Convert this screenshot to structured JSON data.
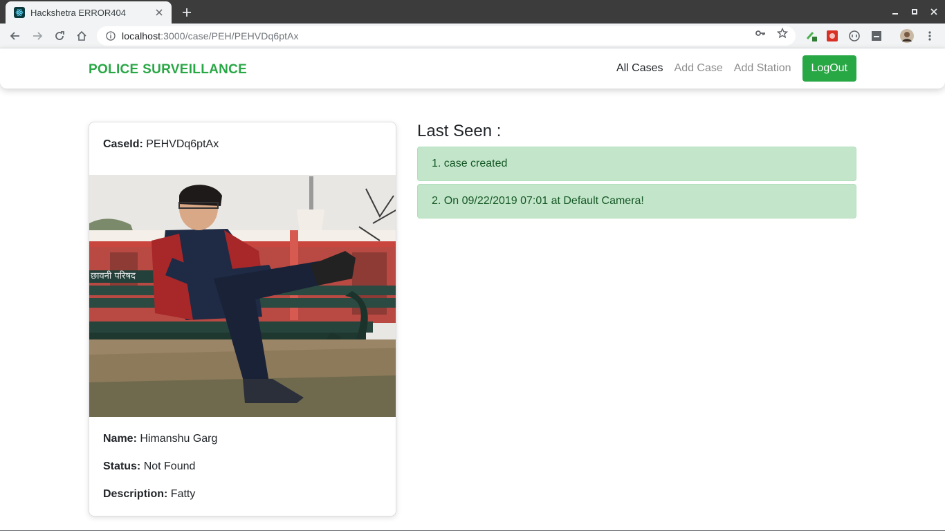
{
  "browser": {
    "tab_title": "Hackshetra ERROR404",
    "url_host": "localhost",
    "url_path": ":3000/case/PEH/PEHVDq6ptAx",
    "icons": [
      "react-favicon-icon",
      "close-icon",
      "plus-icon",
      "minimize-icon",
      "maximize-icon",
      "window-close-icon",
      "back-arrow-icon",
      "forward-arrow-icon",
      "reload-icon",
      "home-icon",
      "info-icon",
      "key-icon",
      "star-icon",
      "extension-icon",
      "profile-avatar-icon",
      "kebab-menu-icon"
    ]
  },
  "navbar": {
    "brand": "POLICE SURVEILLANCE",
    "links": [
      "All Cases",
      "Add Case",
      "Add Station"
    ],
    "logout_label": "LogOut",
    "brand_color": "#28a745"
  },
  "case": {
    "case_id_label": "CaseId:",
    "case_id_value": "PEHVDq6ptAx",
    "photo_sign_text": "छावनी परिषद",
    "name_label": "Name:",
    "name_value": "Himanshu Garg",
    "status_label": "Status:",
    "status_value": "Not Found",
    "description_label": "Description:",
    "description_value": "Fatty"
  },
  "last_seen": {
    "title": "Last Seen :",
    "items": [
      "1. case created",
      "2. On 09/22/2019 07:01 at Default Camera!"
    ],
    "item_bg_color": "#c3e6cb",
    "item_text_color": "#155724"
  }
}
